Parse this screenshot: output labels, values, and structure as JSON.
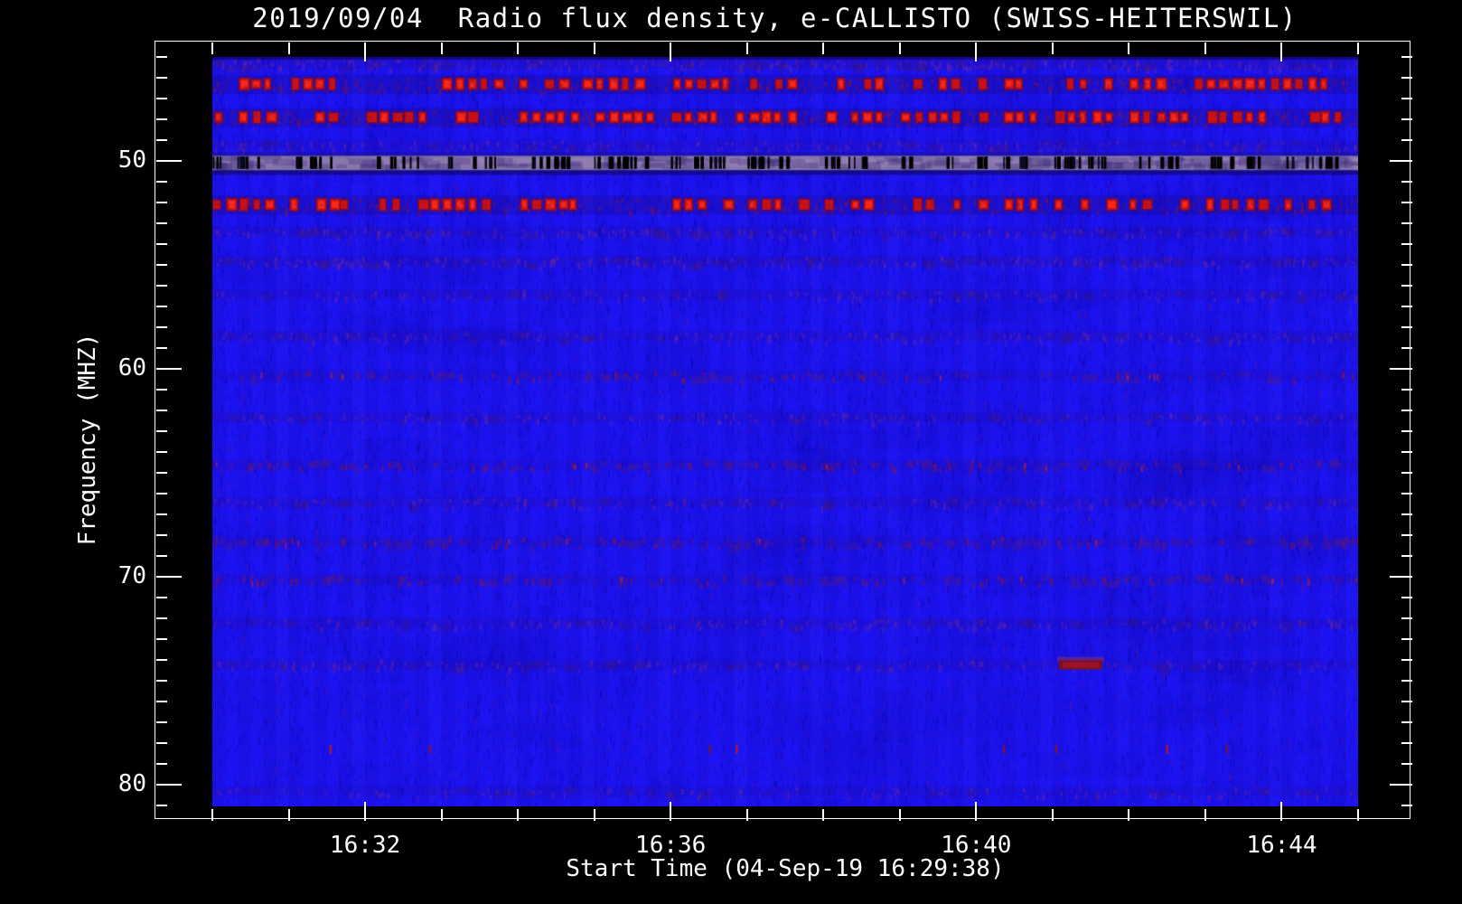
{
  "figure": {
    "background_color": "#000000",
    "frame_color": "#ffffff",
    "text_color": "#ffffff"
  },
  "chart_data": {
    "type": "heatmap",
    "title": "2019/09/04  Radio flux density, e-CALLISTO (SWISS-HEITERSWIL)",
    "xlabel": "Start Time (04-Sep-19 16:29:38)",
    "ylabel": "Frequency (MHZ)",
    "date": "2019/09/04",
    "station": "SWISS-HEITERSWIL",
    "x_axis": {
      "start": "16:30",
      "end": "16:45",
      "minor_tick_interval_min": 1,
      "major_ticks": [
        "16:32",
        "16:36",
        "16:40",
        "16:44"
      ]
    },
    "y_axis": {
      "min_mhz": 45,
      "max_mhz": 81,
      "inverted": true,
      "minor_tick_interval_mhz": 1,
      "major_ticks": [
        50,
        60,
        70,
        80
      ]
    },
    "legend": "none",
    "grid": "off",
    "palette": {
      "background_flux": "#1c13f2",
      "noise_dark_blue": "#0806a0",
      "noise_purple": "#5a1ebe",
      "rfi_bright_red": "#cd1212",
      "rfi_dark_red": "#8c1428",
      "band_50mhz_fill": "#8070a6",
      "band_50mhz_dashes": "#000000"
    },
    "bands": [
      {
        "freq_mhz": 45.3,
        "kind": "purple_speckle",
        "intensity": 0.6
      },
      {
        "freq_mhz": 46.3,
        "kind": "red_blobs",
        "intensity": 0.85
      },
      {
        "freq_mhz": 47.9,
        "kind": "red_blobs",
        "intensity": 1.0
      },
      {
        "freq_mhz": 49.2,
        "kind": "purple_speckle",
        "intensity": 0.35
      },
      {
        "freq_mhz": 50.1,
        "kind": "black_dash_band",
        "intensity": 1.0
      },
      {
        "freq_mhz": 52.1,
        "kind": "red_blobs",
        "intensity": 0.9
      },
      {
        "freq_mhz": 53.4,
        "kind": "purple_speckle",
        "intensity": 0.45
      },
      {
        "freq_mhz": 54.8,
        "kind": "purple_speckle",
        "intensity": 0.55
      },
      {
        "freq_mhz": 56.4,
        "kind": "purple_speckle",
        "intensity": 0.3
      },
      {
        "freq_mhz": 58.4,
        "kind": "purple_speckle",
        "intensity": 0.35
      },
      {
        "freq_mhz": 60.3,
        "kind": "red_speckle",
        "intensity": 0.35
      },
      {
        "freq_mhz": 62.3,
        "kind": "purple_speckle",
        "intensity": 0.3
      },
      {
        "freq_mhz": 64.6,
        "kind": "red_speckle",
        "intensity": 0.5
      },
      {
        "freq_mhz": 66.4,
        "kind": "purple_speckle",
        "intensity": 0.35
      },
      {
        "freq_mhz": 68.3,
        "kind": "red_speckle",
        "intensity": 0.55
      },
      {
        "freq_mhz": 70.1,
        "kind": "red_speckle",
        "intensity": 0.5
      },
      {
        "freq_mhz": 72.2,
        "kind": "purple_speckle",
        "intensity": 0.35
      },
      {
        "freq_mhz": 74.2,
        "kind": "purple_speckle",
        "intensity": 0.3
      },
      {
        "freq_mhz": 80.3,
        "kind": "purple_speckle",
        "intensity": 0.25
      }
    ],
    "burst": {
      "time": "16:41:05",
      "freq_mhz": 74.2,
      "duration_s": 20,
      "color": "#7c0e20"
    },
    "sparse_dots": {
      "freq_mhz": 78.3,
      "times": [
        "16:31:32",
        "16:32:50",
        "16:36:30",
        "16:36:51",
        "16:40:21",
        "16:41:02",
        "16:42:29",
        "16:43:16"
      ]
    }
  }
}
